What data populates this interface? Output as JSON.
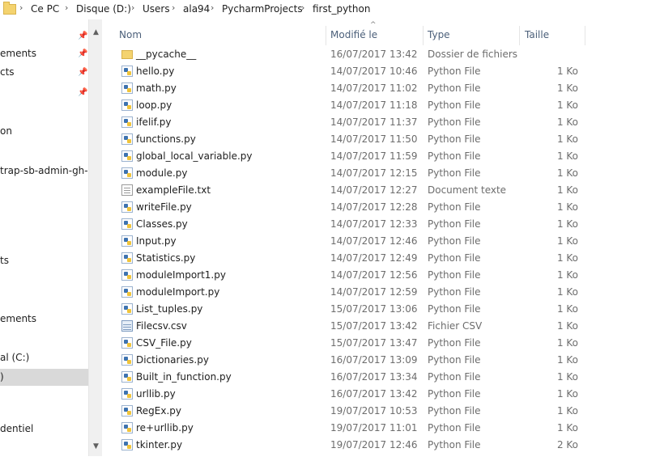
{
  "breadcrumbs": [
    "Ce PC",
    "Disque (D:)",
    "Users",
    "ala94",
    "PycharmProjects",
    "first_python"
  ],
  "nav": {
    "items": [
      "ements",
      "cts",
      "on",
      "trap-sb-admin-gh-pa",
      "ts",
      "ements",
      "al (C:)",
      ")",
      "dentiel"
    ]
  },
  "columns": {
    "name": "Nom",
    "modified": "Modifié le",
    "type": "Type",
    "size": "Taille"
  },
  "files": [
    {
      "name": "__pycache__",
      "modified": "16/07/2017 13:42",
      "type": "Dossier de fichiers",
      "size": "",
      "icon": "folder-icon"
    },
    {
      "name": "hello.py",
      "modified": "14/07/2017 10:46",
      "type": "Python File",
      "size": "1 Ko",
      "icon": "python-file-icon"
    },
    {
      "name": "math.py",
      "modified": "14/07/2017 11:02",
      "type": "Python File",
      "size": "1 Ko",
      "icon": "python-file-icon"
    },
    {
      "name": "loop.py",
      "modified": "14/07/2017 11:18",
      "type": "Python File",
      "size": "1 Ko",
      "icon": "python-file-icon"
    },
    {
      "name": "ifelif.py",
      "modified": "14/07/2017 11:37",
      "type": "Python File",
      "size": "1 Ko",
      "icon": "python-file-icon"
    },
    {
      "name": "functions.py",
      "modified": "14/07/2017 11:50",
      "type": "Python File",
      "size": "1 Ko",
      "icon": "python-file-icon"
    },
    {
      "name": "global_local_variable.py",
      "modified": "14/07/2017 11:59",
      "type": "Python File",
      "size": "1 Ko",
      "icon": "python-file-icon"
    },
    {
      "name": "module.py",
      "modified": "14/07/2017 12:15",
      "type": "Python File",
      "size": "1 Ko",
      "icon": "python-file-icon"
    },
    {
      "name": "exampleFile.txt",
      "modified": "14/07/2017 12:27",
      "type": "Document texte",
      "size": "1 Ko",
      "icon": "text-file-icon"
    },
    {
      "name": "writeFile.py",
      "modified": "14/07/2017 12:28",
      "type": "Python File",
      "size": "1 Ko",
      "icon": "python-file-icon"
    },
    {
      "name": "Classes.py",
      "modified": "14/07/2017 12:33",
      "type": "Python File",
      "size": "1 Ko",
      "icon": "python-file-icon"
    },
    {
      "name": "Input.py",
      "modified": "14/07/2017 12:46",
      "type": "Python File",
      "size": "1 Ko",
      "icon": "python-file-icon"
    },
    {
      "name": "Statistics.py",
      "modified": "14/07/2017 12:49",
      "type": "Python File",
      "size": "1 Ko",
      "icon": "python-file-icon"
    },
    {
      "name": "moduleImport1.py",
      "modified": "14/07/2017 12:56",
      "type": "Python File",
      "size": "1 Ko",
      "icon": "python-file-icon"
    },
    {
      "name": "moduleImport.py",
      "modified": "14/07/2017 12:59",
      "type": "Python File",
      "size": "1 Ko",
      "icon": "python-file-icon"
    },
    {
      "name": "List_tuples.py",
      "modified": "15/07/2017 13:06",
      "type": "Python File",
      "size": "1 Ko",
      "icon": "python-file-icon"
    },
    {
      "name": "Filecsv.csv",
      "modified": "15/07/2017 13:42",
      "type": "Fichier CSV",
      "size": "1 Ko",
      "icon": "csv-file-icon"
    },
    {
      "name": "CSV_File.py",
      "modified": "15/07/2017 13:47",
      "type": "Python File",
      "size": "1 Ko",
      "icon": "python-file-icon"
    },
    {
      "name": "Dictionaries.py",
      "modified": "16/07/2017 13:09",
      "type": "Python File",
      "size": "1 Ko",
      "icon": "python-file-icon"
    },
    {
      "name": "Built_in_function.py",
      "modified": "16/07/2017 13:34",
      "type": "Python File",
      "size": "1 Ko",
      "icon": "python-file-icon"
    },
    {
      "name": "urllib.py",
      "modified": "16/07/2017 13:42",
      "type": "Python File",
      "size": "1 Ko",
      "icon": "python-file-icon"
    },
    {
      "name": "RegEx.py",
      "modified": "19/07/2017 10:53",
      "type": "Python File",
      "size": "1 Ko",
      "icon": "python-file-icon"
    },
    {
      "name": "re+urllib.py",
      "modified": "19/07/2017 11:01",
      "type": "Python File",
      "size": "1 Ko",
      "icon": "python-file-icon"
    },
    {
      "name": "tkinter.py",
      "modified": "19/07/2017 12:46",
      "type": "Python File",
      "size": "2 Ko",
      "icon": "python-file-icon"
    }
  ]
}
